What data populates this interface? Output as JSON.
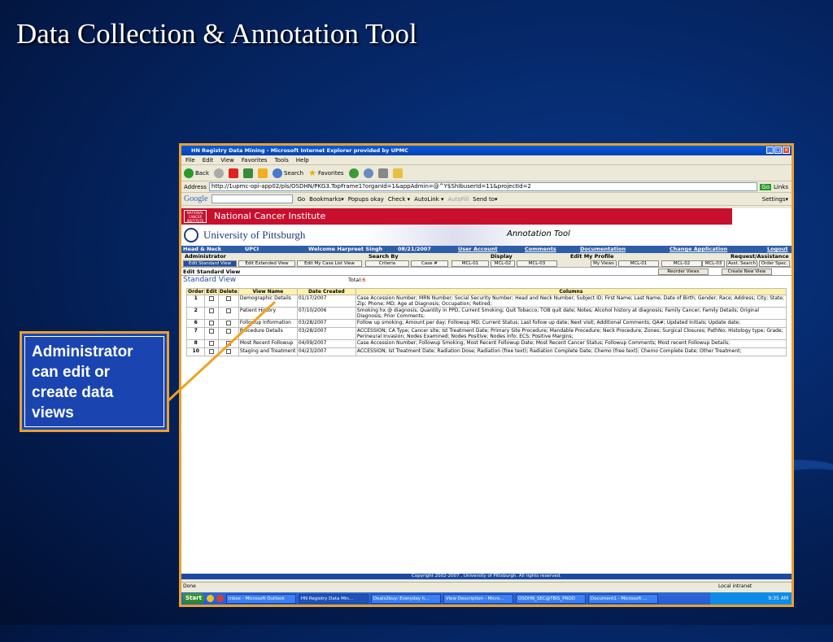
{
  "slide": {
    "title": "Data Collection & Annotation Tool",
    "callout": "Administrator can edit or create data views"
  },
  "window": {
    "title": "HN Registry Data Mining - Microsoft Internet Explorer provided by UPMC",
    "controls": [
      "_",
      "□",
      "×"
    ]
  },
  "menu": [
    "File",
    "Edit",
    "View",
    "Favorites",
    "Tools",
    "Help"
  ],
  "toolbar": {
    "back": "Back",
    "search": "Search",
    "favorites": "Favorites"
  },
  "address": {
    "label": "Address",
    "url": "http://1upmc-opi-app02/pls/OSDHN/PKG3.TopFrame1?organId=1&appAdmin=@^Y$ShIbuserId=11&projectId=2",
    "go": "Go",
    "links": "Links"
  },
  "googlebar": {
    "label": "Google",
    "go": "Go",
    "bookmarks": "Bookmarks▾",
    "popups": "Popups okay",
    "check": "Check ▾",
    "autolink": "AutoLink ▾",
    "autofill": "AutoFill",
    "sendto": "Send to▾",
    "settings": "Settings▾"
  },
  "page": {
    "nci": "National Cancer Institute",
    "nci_logo": "NATIONAL CANCER INSTITUTE",
    "university": "University of Pittsburgh",
    "app_title": "Annotation Tool",
    "nav": {
      "project": "Head & Neck",
      "org": "UPCI",
      "welcome": "Welcome Harpreet Singh",
      "date": "08/21/2007",
      "links": [
        "User Account",
        "Comments",
        "Documentation",
        "Change Application",
        "Logout"
      ]
    },
    "roles": [
      "Administrator",
      "Search By",
      "Display",
      "Edit My Profile",
      "Request/Assistance"
    ],
    "subtabs": [
      "Edit Standard View",
      "Edit Extended View",
      "Edit My Case List View",
      "Criteria",
      "Case #",
      "MCL-01",
      "MCL-02",
      "MCL-03",
      "My Views",
      "MCL-01",
      "MCL-02",
      "MCL-03",
      "Asst. Search",
      "Order Spec."
    ],
    "edit_header": "Edit Standard View",
    "reorder": "Reorder Views",
    "create": "Create New View",
    "standard_view": "Standard View",
    "total_label": "Total:",
    "total_value": "6",
    "columns": [
      "Order",
      "Edit",
      "Delete",
      "View Name",
      "Date Created",
      "Columns"
    ],
    "rows": [
      {
        "order": "1",
        "name": "Demographic Details",
        "date": "01/17/2007",
        "cols": "Case Accession Number; MRN Number; Social Security Number; Head and Neck Number; Subject ID; First Name; Last Name; Date of Birth; Gender; Race; Address; City; State; Zip; Phone; MD; Age at Diagnosis; Occupation; Retired;"
      },
      {
        "order": "2",
        "name": "Patient History",
        "date": "07/10/2006",
        "cols": "Smoking hx @ diagnosis; Quantity in PPD; Current Smoking; Quit Tobacco; TOB quit date; Notes; Alcohol history at diagnosis; Family Cancer; Family Details; Original Diagnosis; Prior Comments;"
      },
      {
        "order": "6",
        "name": "Followup Information",
        "date": "03/28/2007",
        "cols": "Follow up smoking; Amount per day; Followup MD; Current Status; Last follow up date; Next visit; Additional Comments; QA#; Updated Initials; Update date;"
      },
      {
        "order": "7",
        "name": "Procedure Details",
        "date": "03/28/2007",
        "cols": "ACCESSION; CA Type; Cancer site; Ist Treatment Date; Primary Site Procedure; Mandable Procedure; Neck Procedure; Zones; Surgical Closures; PathNo; Histology type; Grade; Perineural Invasion; Nodes Examined; Nodes Positive; Nodes Info; ECS; Positive Margins;"
      },
      {
        "order": "8",
        "name": "Most Recent Followup",
        "date": "04/09/2007",
        "cols": "Case Accession Number; Followup Smoking; Most Recent Followup Date; Most Recent Cancer Status; Followup Comments; Most recent Followup Details;"
      },
      {
        "order": "10",
        "name": "Staging and Treatment",
        "date": "04/23/2007",
        "cols": "ACCESSION; Ist Treatment Date; Radiation Dose; Radiation (free text); Radiation Complete Date; Chemo (free text); Chemo Complete Date; Other Treatment;"
      }
    ],
    "copyright": "Copyright 2002-2007 , University of Pittsburgh. All rights reserved."
  },
  "status": {
    "left": "Done",
    "right": "Local intranet"
  },
  "taskbar": {
    "start": "Start",
    "items": [
      "Inbox - Microsoft Outlook",
      "HN Registry Data Min...",
      "Deals2buy: Everyday h...",
      "View Description - Micro...",
      "OSDHN_SEC@TBIS_PROD",
      "Document1 - Microsoft ..."
    ],
    "clock": "9:35 AM"
  },
  "colors": {
    "nci_red": "#c8102e",
    "nav_blue": "#2e5ea8",
    "callout_bg": "#1a45b0",
    "accent_orange": "#e8a030"
  }
}
